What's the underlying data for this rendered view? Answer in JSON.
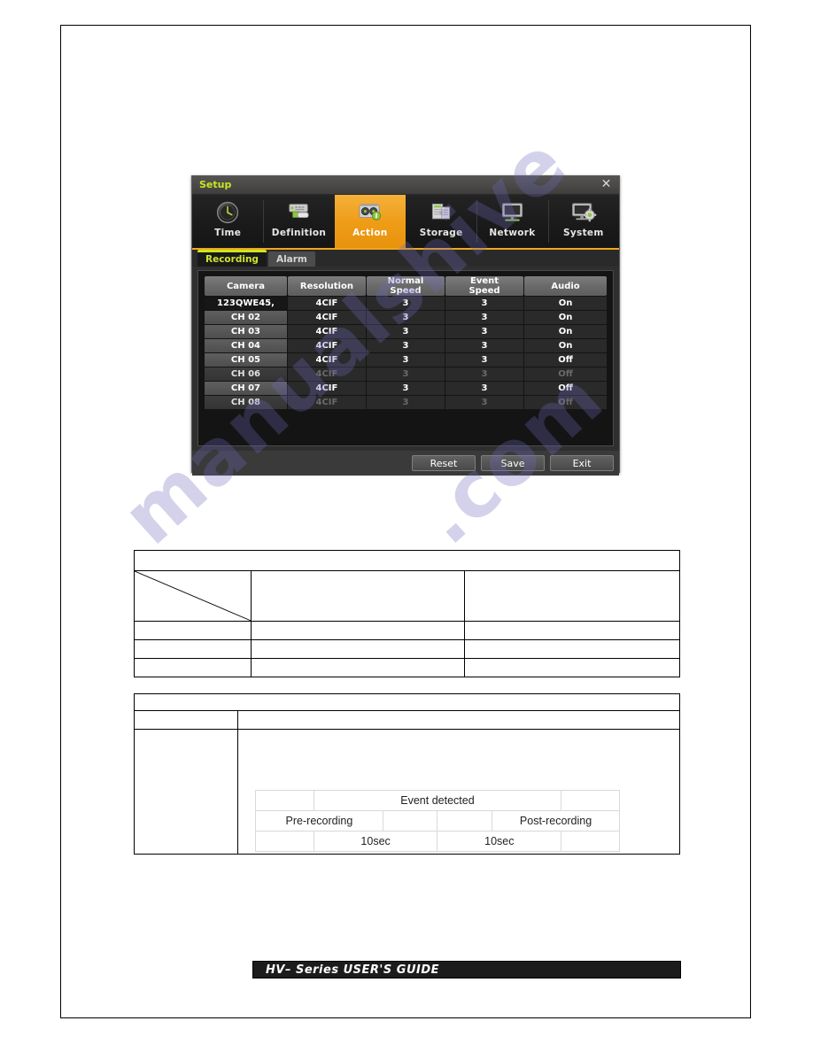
{
  "document": {
    "footer_banner": "HV– Series USER'S GUIDE"
  },
  "watermark": {
    "line1": "manualshive",
    "line2": ".com"
  },
  "dialog": {
    "title": "Setup",
    "close_icon": "close-icon",
    "nav": [
      {
        "label": "Time",
        "icon": "clock-icon",
        "active": false
      },
      {
        "label": "Definition",
        "icon": "video-server-icon",
        "active": false
      },
      {
        "label": "Action",
        "icon": "action-icon",
        "active": true
      },
      {
        "label": "Storage",
        "icon": "storage-icon",
        "active": false
      },
      {
        "label": "Network",
        "icon": "monitor-network-icon",
        "active": false
      },
      {
        "label": "System",
        "icon": "monitor-gear-icon",
        "active": false
      }
    ],
    "tabs": [
      {
        "label": "Recording",
        "active": true
      },
      {
        "label": "Alarm",
        "active": false
      }
    ],
    "table": {
      "headers": [
        "Camera",
        "Resolution",
        "Normal\nSpeed",
        "Event\nSpeed",
        "Audio"
      ],
      "headers_flat": {
        "camera": "Camera",
        "resolution": "Resolution",
        "normal_speed_l1": "Normal",
        "normal_speed_l2": "Speed",
        "event_speed_l1": "Event",
        "event_speed_l2": "Speed",
        "audio": "Audio"
      },
      "rows": [
        {
          "camera": "123QWE45,",
          "resolution": "4CIF",
          "normal_speed": "3",
          "event_speed": "3",
          "audio": "On",
          "dim": false,
          "selected": true,
          "audio_off": false
        },
        {
          "camera": "CH 02",
          "resolution": "4CIF",
          "normal_speed": "3",
          "event_speed": "3",
          "audio": "On",
          "dim": false,
          "selected": false,
          "audio_off": false
        },
        {
          "camera": "CH 03",
          "resolution": "4CIF",
          "normal_speed": "3",
          "event_speed": "3",
          "audio": "On",
          "dim": false,
          "selected": false,
          "audio_off": false
        },
        {
          "camera": "CH 04",
          "resolution": "4CIF",
          "normal_speed": "3",
          "event_speed": "3",
          "audio": "On",
          "dim": false,
          "selected": false,
          "audio_off": false
        },
        {
          "camera": "CH 05",
          "resolution": "4CIF",
          "normal_speed": "3",
          "event_speed": "3",
          "audio": "Off",
          "dim": false,
          "selected": false,
          "audio_off": true
        },
        {
          "camera": "CH 06",
          "resolution": "4CIF",
          "normal_speed": "3",
          "event_speed": "3",
          "audio": "Off",
          "dim": true,
          "selected": false,
          "audio_off": true
        },
        {
          "camera": "CH 07",
          "resolution": "4CIF",
          "normal_speed": "3",
          "event_speed": "3",
          "audio": "Off",
          "dim": false,
          "selected": false,
          "audio_off": true
        },
        {
          "camera": "CH 08",
          "resolution": "4CIF",
          "normal_speed": "3",
          "event_speed": "3",
          "audio": "Off",
          "dim": true,
          "selected": false,
          "audio_off": true
        }
      ]
    },
    "buttons": [
      {
        "label": "Reset"
      },
      {
        "label": "Save"
      },
      {
        "label": "Exit"
      }
    ],
    "colors": {
      "accent_orange": "#ef9d18",
      "accent_yellow": "#c8e820",
      "dialog_bg": "#3a3a3a",
      "table_bg": "#141414"
    }
  },
  "event_diagram": {
    "title": "Event detected",
    "pre_label": "Pre-recording",
    "post_label": "Post-recording",
    "pre_value": "10sec",
    "post_value": "10sec"
  }
}
